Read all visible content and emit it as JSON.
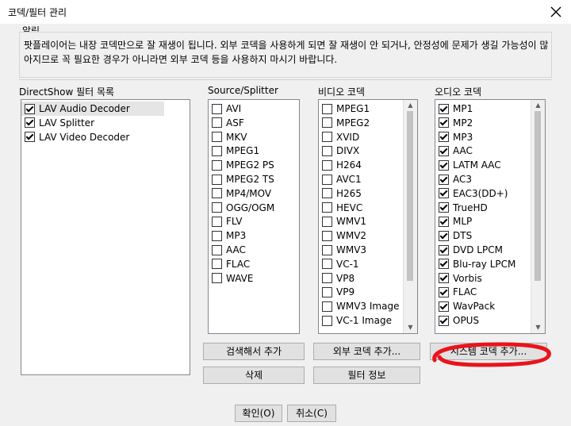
{
  "window": {
    "title": "코덱/필터 관리"
  },
  "notice": {
    "label": "알림",
    "text": "팟플레이어는 내장 코덱만으로 잘 재생이 됩니다. 외부 코덱을 사용하게 되면 잘 재생이 안 되거나, 안정성에 문제가 생길 가능성이 많아지므로 꼭 필요한 경우가 아니라면 외부 코덱 등을 사용하지 마시기 바랍니다."
  },
  "directshow": {
    "label": "DirectShow 필터 목록",
    "items": [
      {
        "label": "LAV Audio Decoder",
        "checked": true
      },
      {
        "label": "LAV Splitter",
        "checked": true
      },
      {
        "label": "LAV Video Decoder",
        "checked": true
      }
    ]
  },
  "source": {
    "label": "Source/Splitter",
    "items": [
      {
        "label": "AVI",
        "checked": false
      },
      {
        "label": "ASF",
        "checked": false
      },
      {
        "label": "MKV",
        "checked": false
      },
      {
        "label": "MPEG1",
        "checked": false
      },
      {
        "label": "MPEG2 PS",
        "checked": false
      },
      {
        "label": "MPEG2 TS",
        "checked": false
      },
      {
        "label": "MP4/MOV",
        "checked": false
      },
      {
        "label": "OGG/OGM",
        "checked": false
      },
      {
        "label": "FLV",
        "checked": false
      },
      {
        "label": "MP3",
        "checked": false
      },
      {
        "label": "AAC",
        "checked": false
      },
      {
        "label": "FLAC",
        "checked": false
      },
      {
        "label": "WAVE",
        "checked": false
      }
    ]
  },
  "video": {
    "label": "비디오 코덱",
    "items": [
      {
        "label": "MPEG1",
        "checked": false
      },
      {
        "label": "MPEG2",
        "checked": false
      },
      {
        "label": "XVID",
        "checked": false
      },
      {
        "label": "DIVX",
        "checked": false
      },
      {
        "label": "H264",
        "checked": false
      },
      {
        "label": "AVC1",
        "checked": false
      },
      {
        "label": "H265",
        "checked": false
      },
      {
        "label": "HEVC",
        "checked": false
      },
      {
        "label": "WMV1",
        "checked": false
      },
      {
        "label": "WMV2",
        "checked": false
      },
      {
        "label": "WMV3",
        "checked": false
      },
      {
        "label": "VC-1",
        "checked": false
      },
      {
        "label": "VP8",
        "checked": false
      },
      {
        "label": "VP9",
        "checked": false
      },
      {
        "label": "WMV3 Image",
        "checked": false
      },
      {
        "label": "VC-1 Image",
        "checked": false
      }
    ]
  },
  "audio": {
    "label": "오디오 코덱",
    "items": [
      {
        "label": "MP1",
        "checked": true
      },
      {
        "label": "MP2",
        "checked": true
      },
      {
        "label": "MP3",
        "checked": true
      },
      {
        "label": "AAC",
        "checked": true
      },
      {
        "label": "LATM AAC",
        "checked": true
      },
      {
        "label": "AC3",
        "checked": true
      },
      {
        "label": "EAC3(DD+)",
        "checked": true
      },
      {
        "label": "TrueHD",
        "checked": true
      },
      {
        "label": "MLP",
        "checked": true
      },
      {
        "label": "DTS",
        "checked": true
      },
      {
        "label": "DVD LPCM",
        "checked": true
      },
      {
        "label": "Blu-ray LPCM",
        "checked": true
      },
      {
        "label": "Vorbis",
        "checked": true
      },
      {
        "label": "FLAC",
        "checked": true
      },
      {
        "label": "WavPack",
        "checked": true
      },
      {
        "label": "OPUS",
        "checked": true
      }
    ]
  },
  "buttons": {
    "search_add": "검색해서 추가",
    "external_add": "외부 코덱 추가...",
    "system_add": "시스템 코덱 추가...",
    "delete": "삭제",
    "filter_info": "필터 정보",
    "ok": "확인(O)",
    "cancel": "취소(C)"
  },
  "icons": {
    "close": "close-icon",
    "scroll_up": "scroll-up-icon",
    "scroll_down": "scroll-down-icon"
  },
  "colors": {
    "annotation": "#e8141c",
    "selected_row": "#e5e5e5"
  }
}
